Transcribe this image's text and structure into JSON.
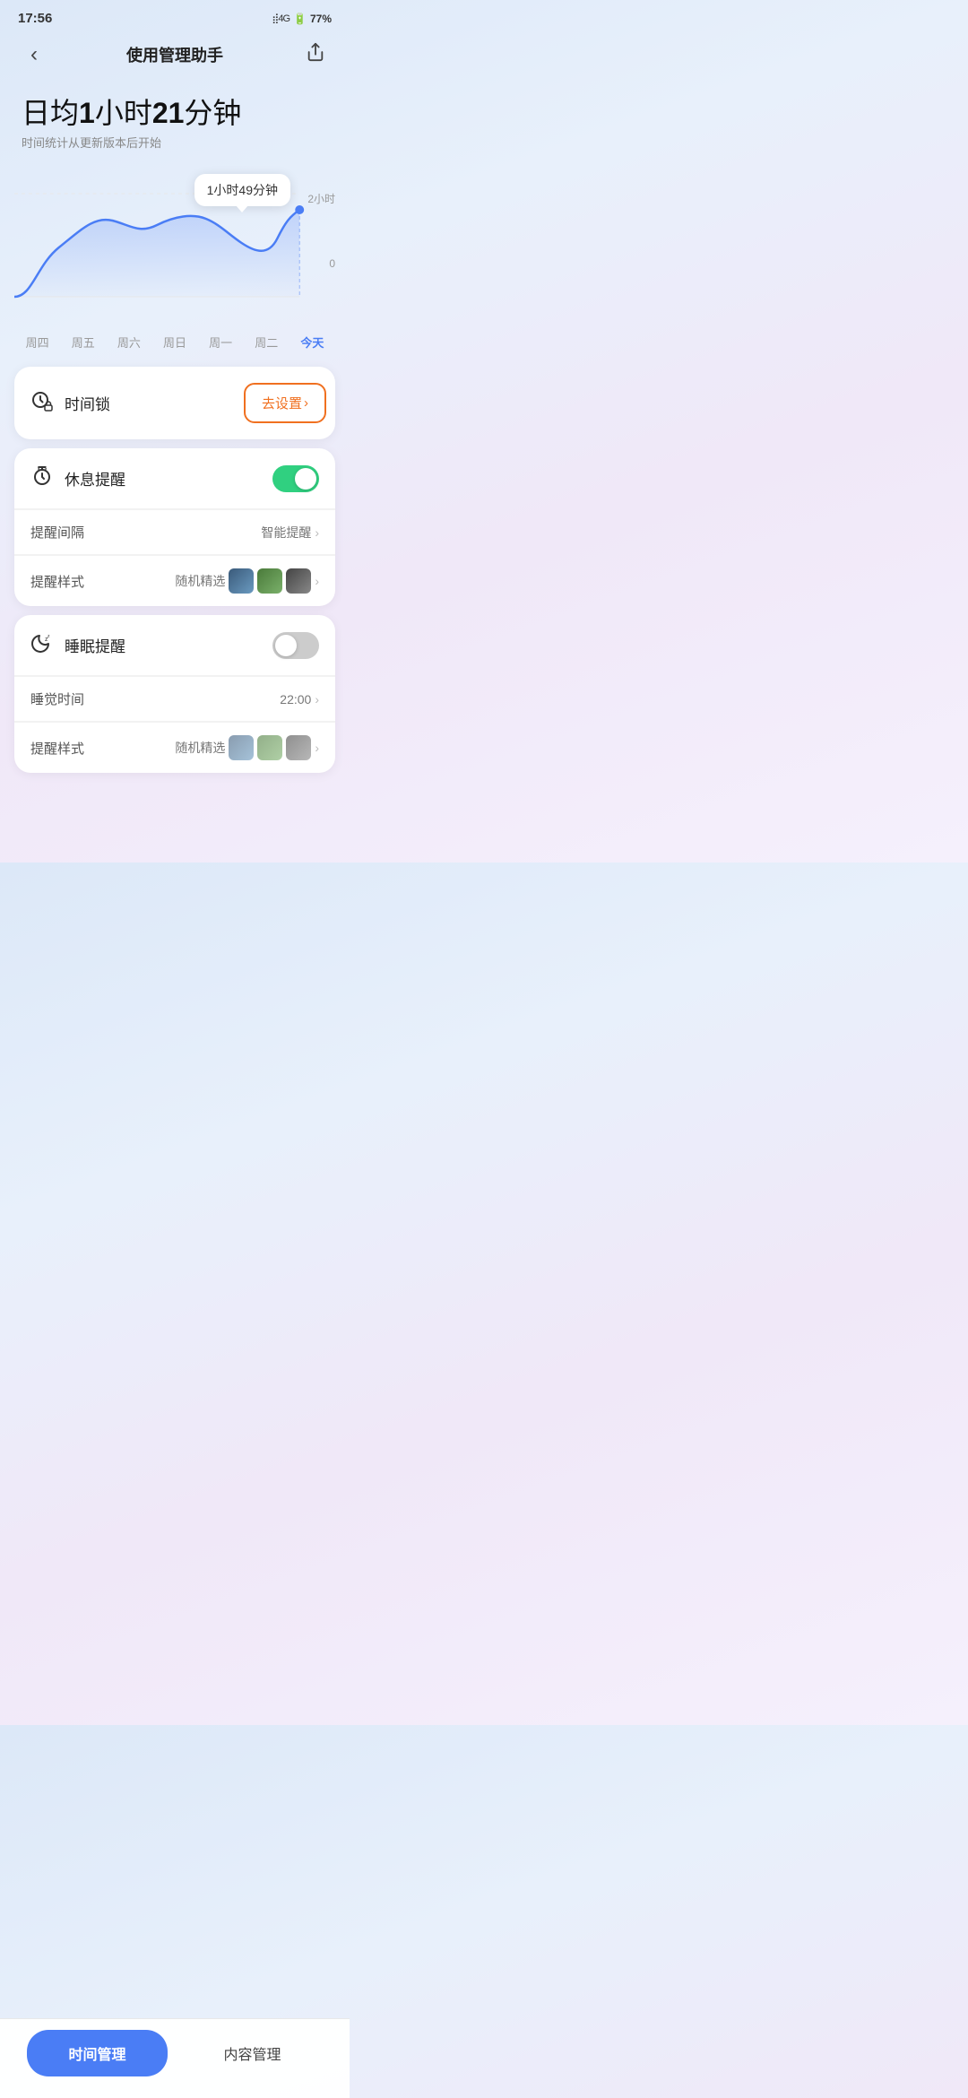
{
  "statusBar": {
    "time": "17:56",
    "battery": "77%",
    "icons": "📶 46 4G"
  },
  "header": {
    "title": "使用管理助手",
    "backLabel": "‹",
    "shareLabel": "⤴"
  },
  "dailyAvg": {
    "prefix": "日均",
    "hours": "1",
    "hourUnit": "小时",
    "minutes": "21",
    "minuteUnit": "分钟",
    "subtitle": "时间统计从更新版本后开始"
  },
  "chart": {
    "tooltipText": "1小时49分钟",
    "yLabels": [
      "2小时",
      "0"
    ],
    "dotLabel": "2小时",
    "days": [
      {
        "label": "周四",
        "today": false
      },
      {
        "label": "周五",
        "today": false
      },
      {
        "label": "周六",
        "today": false
      },
      {
        "label": "周日",
        "today": false
      },
      {
        "label": "周一",
        "today": false
      },
      {
        "label": "周二",
        "today": false
      },
      {
        "label": "今天",
        "today": true
      }
    ]
  },
  "timeLock": {
    "iconLabel": "⏰",
    "label": "时间锁",
    "btnLabel": "去设置",
    "btnChevron": "›"
  },
  "restReminder": {
    "iconLabel": "⏱",
    "label": "休息提醒",
    "toggleOn": true,
    "subRows": [
      {
        "label": "提醒间隔",
        "value": "智能提醒",
        "hasChevron": true,
        "hasThumbs": false
      },
      {
        "label": "提醒样式",
        "value": "随机精选",
        "hasChevron": true,
        "hasThumbs": true
      }
    ]
  },
  "sleepReminder": {
    "iconLabel": "🌙",
    "label": "睡眠提醒",
    "toggleOn": false,
    "subRows": [
      {
        "label": "睡觉时间",
        "value": "22:00",
        "hasChevron": true,
        "hasThumbs": false
      },
      {
        "label": "提醒样式",
        "value": "随机精选",
        "hasChevron": true,
        "hasThumbs": true
      }
    ]
  },
  "bottomTabs": {
    "active": "时间管理",
    "inactive": "内容管理"
  }
}
